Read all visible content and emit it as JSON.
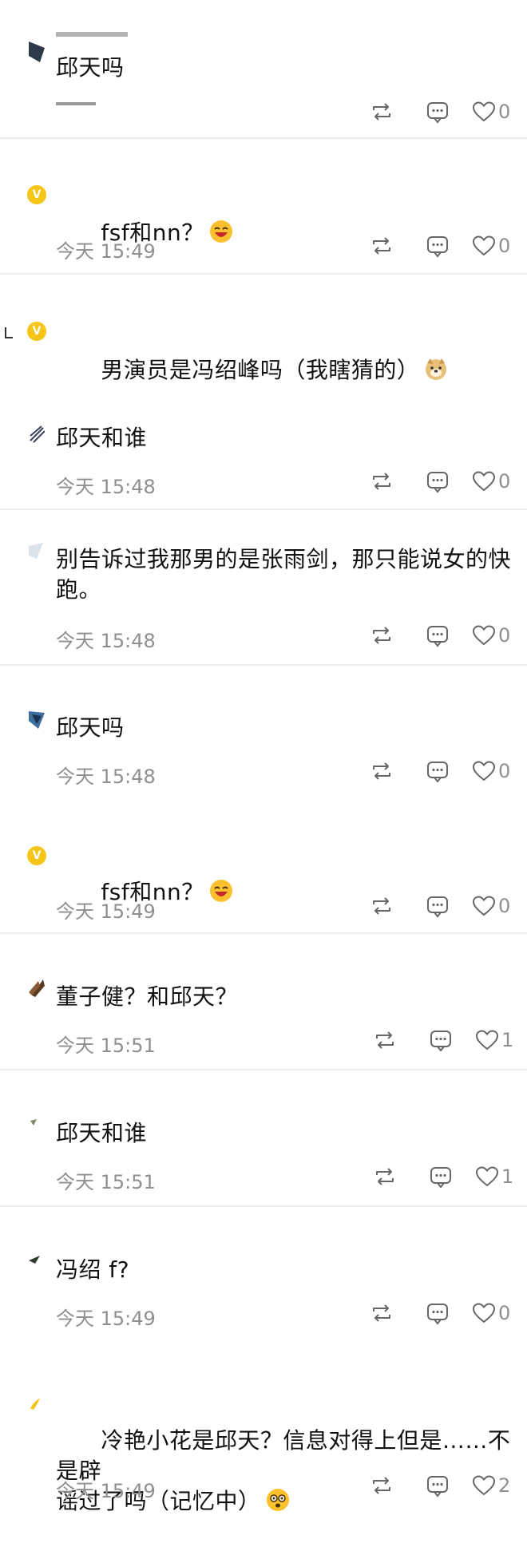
{
  "colors": {
    "text": "#111111",
    "meta": "#8f8f8f",
    "divider": "#eeeeee",
    "badge": "#f5c518"
  },
  "icons": {
    "repost": "repost-icon",
    "comment": "comment-icon",
    "like": "heart-icon"
  },
  "comments": [
    {
      "text": "邱天吗",
      "time": "",
      "likes": "0",
      "avatar": "dark"
    },
    {
      "text": "fsf和nn？",
      "time": "今天 15:49",
      "likes": "0",
      "avatar": "v-badge",
      "emoji": "laugh-emoji"
    },
    {
      "text": "男演员是冯绍峰吗（我瞎猜的）",
      "time": "",
      "likes": "",
      "avatar": "v-badge",
      "emoji": "doge-emoji"
    },
    {
      "text": "邱天和谁",
      "time": "今天 15:48",
      "likes": "0",
      "avatar": "striped"
    },
    {
      "text": "别告诉过我那男的是张雨剑，那只能说女的快\n跑。",
      "time": "今天 15:48",
      "likes": "0",
      "avatar": "light"
    },
    {
      "text": "邱天吗",
      "time": "今天 15:48",
      "likes": "0",
      "avatar": "dark-blue"
    },
    {
      "text": "fsf和nn？",
      "time": "今天 15:49",
      "likes": "0",
      "avatar": "v-badge",
      "emoji": "laugh-emoji"
    },
    {
      "text": "董子健？和邱天？",
      "time": "今天 15:51",
      "likes": "1",
      "avatar": "brown"
    },
    {
      "text": "邱天和谁",
      "time": "今天 15:51",
      "likes": "1",
      "avatar": "small"
    },
    {
      "text": "冯绍 f?",
      "time": "今天 15:49",
      "likes": "0",
      "avatar": "dark-small"
    },
    {
      "text": "冷艳小花是邱天？信息对得上但是……不是辟\n谣过了吗（记忆中）",
      "time": "今天 15:49",
      "likes": "2",
      "avatar": "yellow-small",
      "emoji": "dizzy-emoji"
    }
  ]
}
